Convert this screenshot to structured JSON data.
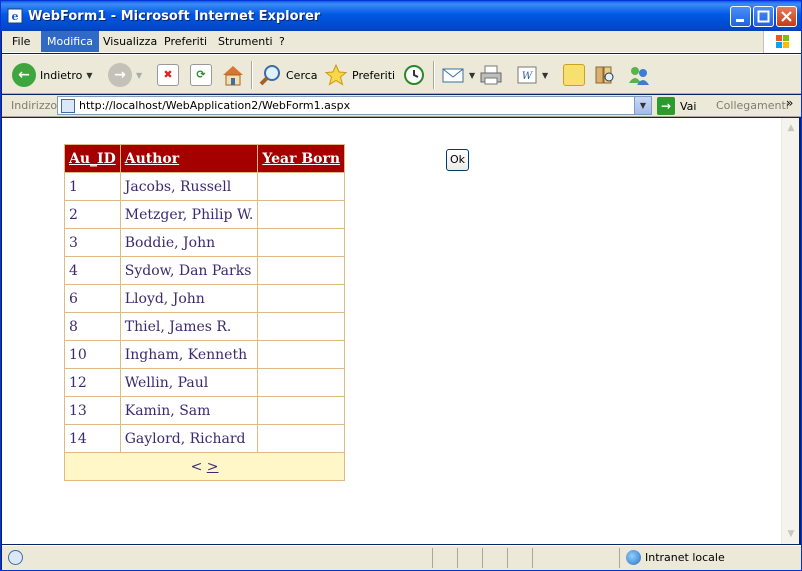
{
  "window": {
    "title": "WebForm1 - Microsoft Internet Explorer"
  },
  "menu": {
    "items": [
      {
        "label": "File",
        "active": false
      },
      {
        "label": "Modifica",
        "active": true
      },
      {
        "label": "Visualizza",
        "active": false
      },
      {
        "label": "Preferiti",
        "active": false
      },
      {
        "label": "Strumenti",
        "active": false
      },
      {
        "label": "?",
        "active": false
      }
    ]
  },
  "toolbar": {
    "back_label": "Indietro",
    "search_label": "Cerca",
    "favorites_label": "Preferiti"
  },
  "address": {
    "label": "Indirizzo",
    "url": "http://localhost/WebApplication2/WebForm1.aspx",
    "go_label": "Vai",
    "links_label": "Collegamenti",
    "chevron": "»"
  },
  "grid": {
    "headers": [
      "Au_ID",
      "Author",
      "Year Born"
    ],
    "rows": [
      [
        "1",
        "Jacobs, Russell",
        ""
      ],
      [
        "2",
        "Metzger, Philip W.",
        ""
      ],
      [
        "3",
        "Boddie, John",
        ""
      ],
      [
        "4",
        "Sydow, Dan Parks",
        ""
      ],
      [
        "6",
        "Lloyd, John",
        ""
      ],
      [
        "8",
        "Thiel, James R.",
        ""
      ],
      [
        "10",
        "Ingham, Kenneth",
        ""
      ],
      [
        "12",
        "Wellin, Paul",
        ""
      ],
      [
        "13",
        "Kamin, Sam",
        ""
      ],
      [
        "14",
        "Gaylord, Richard",
        ""
      ]
    ],
    "pager_prev": "<",
    "pager_next": ">"
  },
  "ok_button": "Ok",
  "status": {
    "zone": "Intranet locale"
  },
  "colors": {
    "header_bg": "#a50000",
    "pager_bg": "#fff7c8",
    "grid_border": "#deba84"
  }
}
